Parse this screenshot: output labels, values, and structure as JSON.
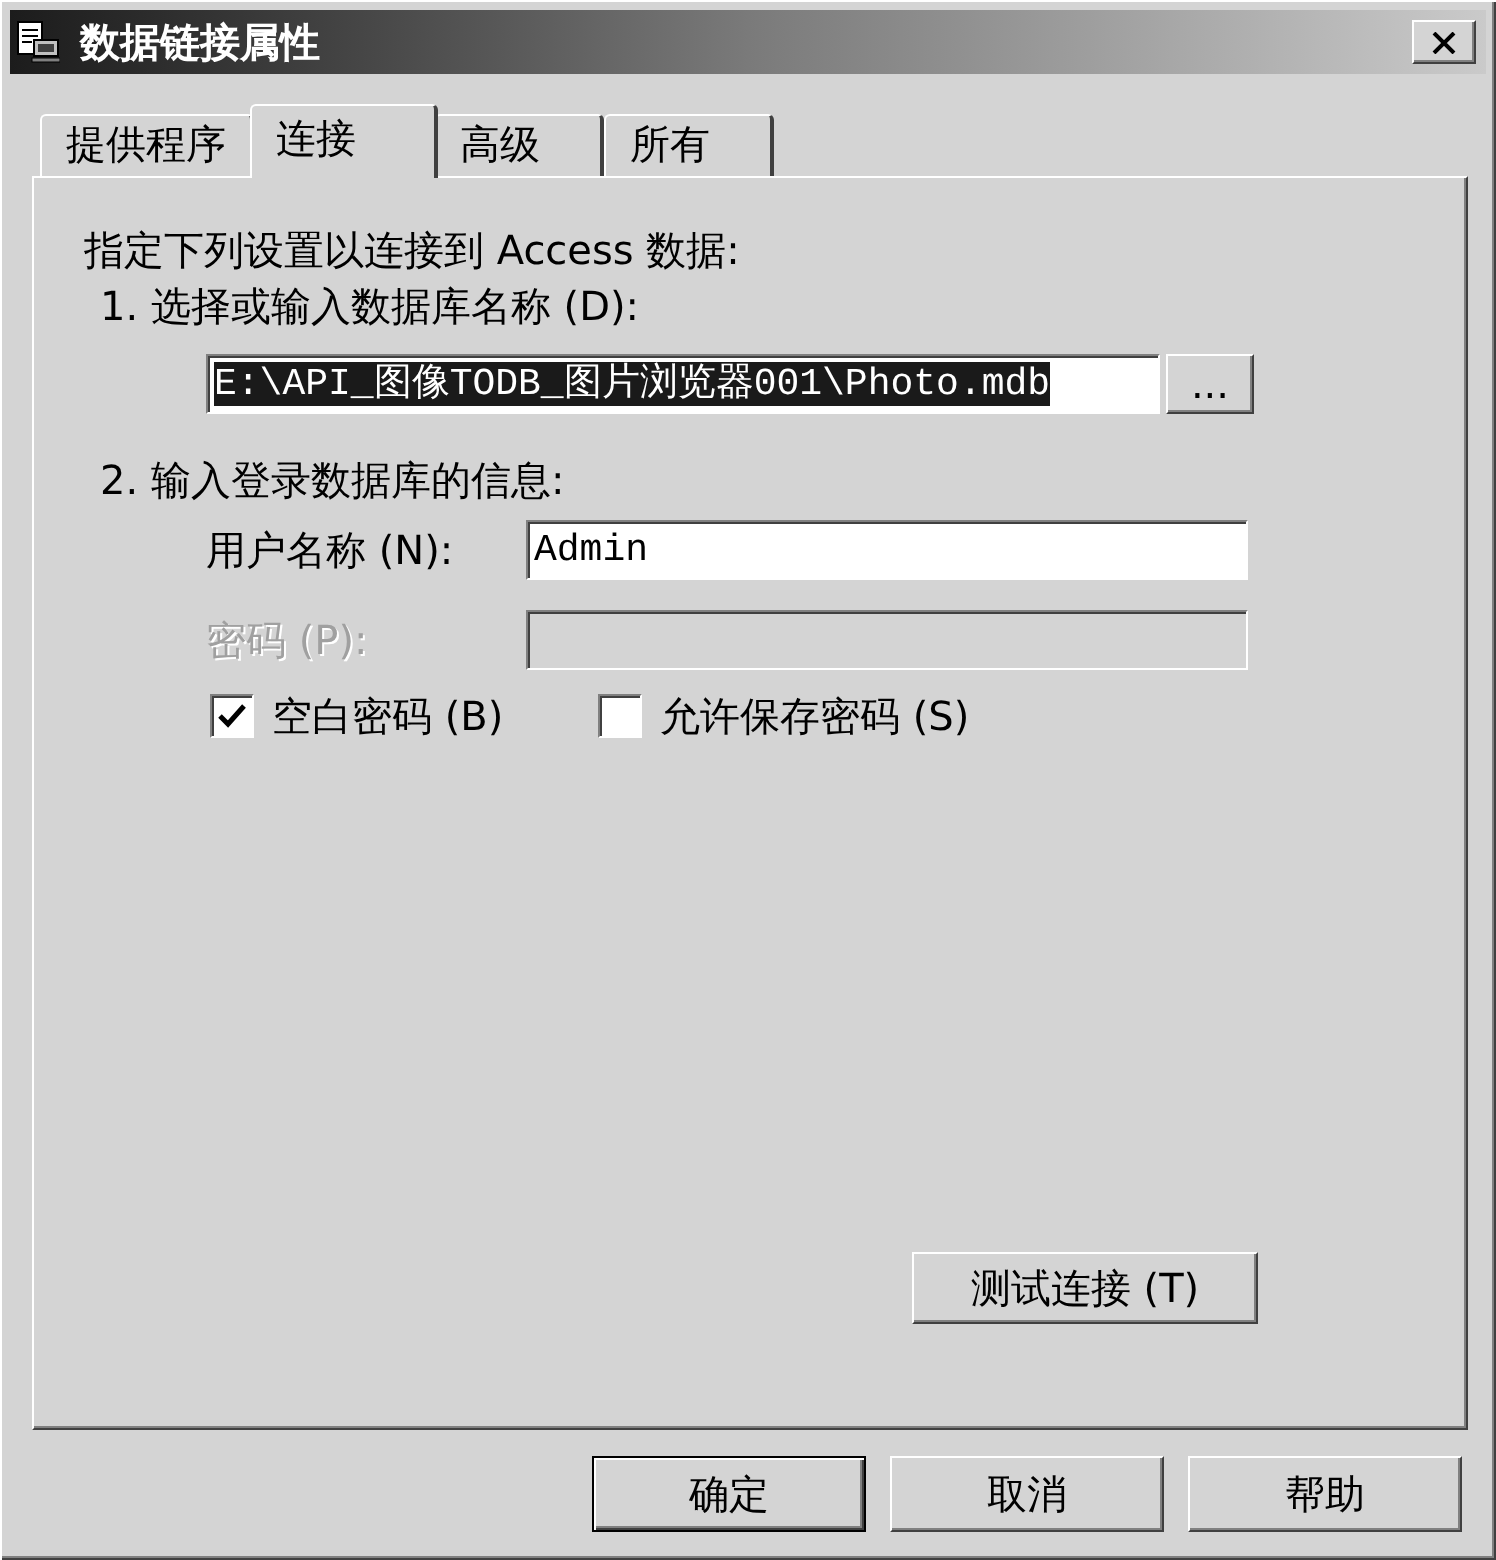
{
  "window": {
    "title": "数据链接属性"
  },
  "tabs": [
    {
      "label": "提供程序",
      "selected": false
    },
    {
      "label": "连接",
      "selected": true
    },
    {
      "label": "高级",
      "selected": false
    },
    {
      "label": "所有",
      "selected": false
    }
  ],
  "connection": {
    "intro": "指定下列设置以连接到 Access 数据:",
    "step_1": {
      "label": "1. 选择或输入数据库名称 (D):",
      "path": {
        "value": "E:\\API_图像TODB_图片浏览器001\\Photo.mdb",
        "highlighted": true
      },
      "browse_button": "..."
    },
    "step_2": {
      "label": "2. 输入登录数据库的信息:",
      "fields": [
        {
          "label": "用户名称 (N):",
          "value": "Admin",
          "disabled": false
        },
        {
          "label": "密码 (P):",
          "disabled": true
        }
      ],
      "checkboxes": [
        {
          "label": "空白密码 (B)",
          "checked": true
        },
        {
          "label": "允许保存密码 (S)",
          "checked": false
        }
      ]
    },
    "test_button": "测试连接 (T)"
  },
  "buttons": [
    {
      "label": "确定",
      "default": true
    },
    {
      "label": "取消",
      "default": false
    },
    {
      "label": "帮助",
      "default": false
    }
  ]
}
